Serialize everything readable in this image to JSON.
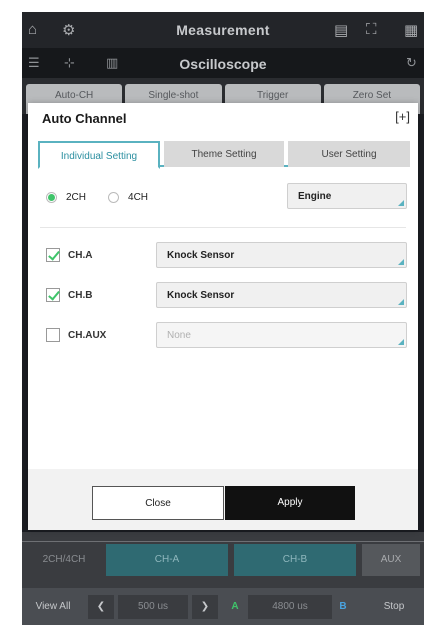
{
  "app": {
    "title": "Measurement",
    "subtitle": "Oscilloscope",
    "toolbar_buttons": [
      "Auto-CH",
      "Single-shot",
      "Trigger",
      "Zero Set"
    ]
  },
  "dialog": {
    "title": "Auto Channel",
    "tabs": [
      "Individual Setting",
      "Theme Setting",
      "User Setting"
    ],
    "active_tab": "Individual Setting",
    "channel_mode": {
      "options": [
        "2CH",
        "4CH"
      ],
      "selected": "2CH"
    },
    "source_select": "Engine",
    "channels": [
      {
        "label": "CH.A",
        "checked": true,
        "sensor": "Knock Sensor"
      },
      {
        "label": "CH.B",
        "checked": true,
        "sensor": "Knock Sensor"
      },
      {
        "label": "CH.AUX",
        "checked": false,
        "sensor": "None"
      }
    ],
    "close_label": "Close",
    "apply_label": "Apply"
  },
  "bottom": {
    "mode": "2CH/4CH",
    "ch_tabs": [
      "CH-A",
      "CH-B",
      "AUX"
    ],
    "view_all": "View All",
    "time_a": "500 us",
    "time_b": "4800 us",
    "marker_a": "A",
    "marker_b": "B",
    "stop": "Stop"
  },
  "colors": {
    "accent": "#5ab2c0",
    "check_green": "#3fc46a",
    "apply_bg": "#111111"
  }
}
